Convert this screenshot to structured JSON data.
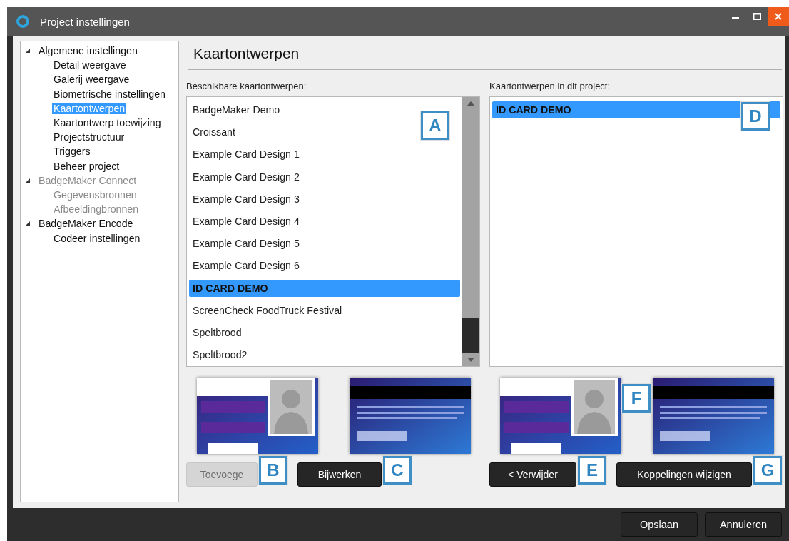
{
  "window": {
    "title": "Project instellingen"
  },
  "tree": [
    {
      "label": "Algemene instellingen",
      "expanded": true,
      "selected": false,
      "disabled": false,
      "children": [
        {
          "label": "Detail weergave",
          "selected": false,
          "disabled": false
        },
        {
          "label": "Galerij weergave",
          "selected": false,
          "disabled": false
        },
        {
          "label": "Biometrische instellingen",
          "selected": false,
          "disabled": false
        },
        {
          "label": "Kaartontwerpen",
          "selected": true,
          "disabled": false
        },
        {
          "label": "Kaartontwerp toewijzing",
          "selected": false,
          "disabled": false
        },
        {
          "label": "Projectstructuur",
          "selected": false,
          "disabled": false
        },
        {
          "label": "Triggers",
          "selected": false,
          "disabled": false
        },
        {
          "label": "Beheer project",
          "selected": false,
          "disabled": false
        }
      ]
    },
    {
      "label": "BadgeMaker Connect",
      "expanded": true,
      "selected": false,
      "disabled": true,
      "children": [
        {
          "label": "Gegevensbronnen",
          "selected": false,
          "disabled": true
        },
        {
          "label": "Afbeeldingbronnen",
          "selected": false,
          "disabled": true
        }
      ]
    },
    {
      "label": "BadgeMaker Encode",
      "expanded": true,
      "selected": false,
      "disabled": false,
      "children": [
        {
          "label": "Codeer instellingen",
          "selected": false,
          "disabled": false
        }
      ]
    }
  ],
  "page_title": "Kaartontwerpen",
  "available": {
    "heading": "Beschikbare kaartontwerpen:",
    "callout": "A",
    "items": [
      {
        "label": "BadgeMaker Demo",
        "selected": false
      },
      {
        "label": "Croissant",
        "selected": false
      },
      {
        "label": "Example Card Design 1",
        "selected": false
      },
      {
        "label": "Example Card Design 2",
        "selected": false
      },
      {
        "label": "Example Card Design 3",
        "selected": false
      },
      {
        "label": "Example Card Design 4",
        "selected": false
      },
      {
        "label": "Example Card Design 5",
        "selected": false
      },
      {
        "label": "Example Card Design 6",
        "selected": false
      },
      {
        "label": "ID CARD DEMO",
        "selected": true
      },
      {
        "label": "ScreenCheck FoodTruck Festival",
        "selected": false
      },
      {
        "label": "Speltbrood",
        "selected": false
      },
      {
        "label": "Speltbrood2",
        "selected": false
      }
    ],
    "buttons": [
      {
        "label": "Toevoege",
        "disabled": true,
        "callout": "B"
      },
      {
        "label": "Bijwerken",
        "disabled": false,
        "callout": "C"
      }
    ]
  },
  "project": {
    "heading": "Kaartontwerpen in dit project:",
    "callout": "D",
    "preview_callout": "F",
    "items": [
      {
        "label": "ID CARD DEMO",
        "selected": true
      }
    ],
    "buttons": [
      {
        "label": "< Verwijder",
        "disabled": false,
        "callout": "E"
      },
      {
        "label": "Koppelingen wijzigen",
        "disabled": false,
        "callout": "G"
      }
    ]
  },
  "footer_buttons": [
    "Opslaan",
    "Annuleren"
  ]
}
